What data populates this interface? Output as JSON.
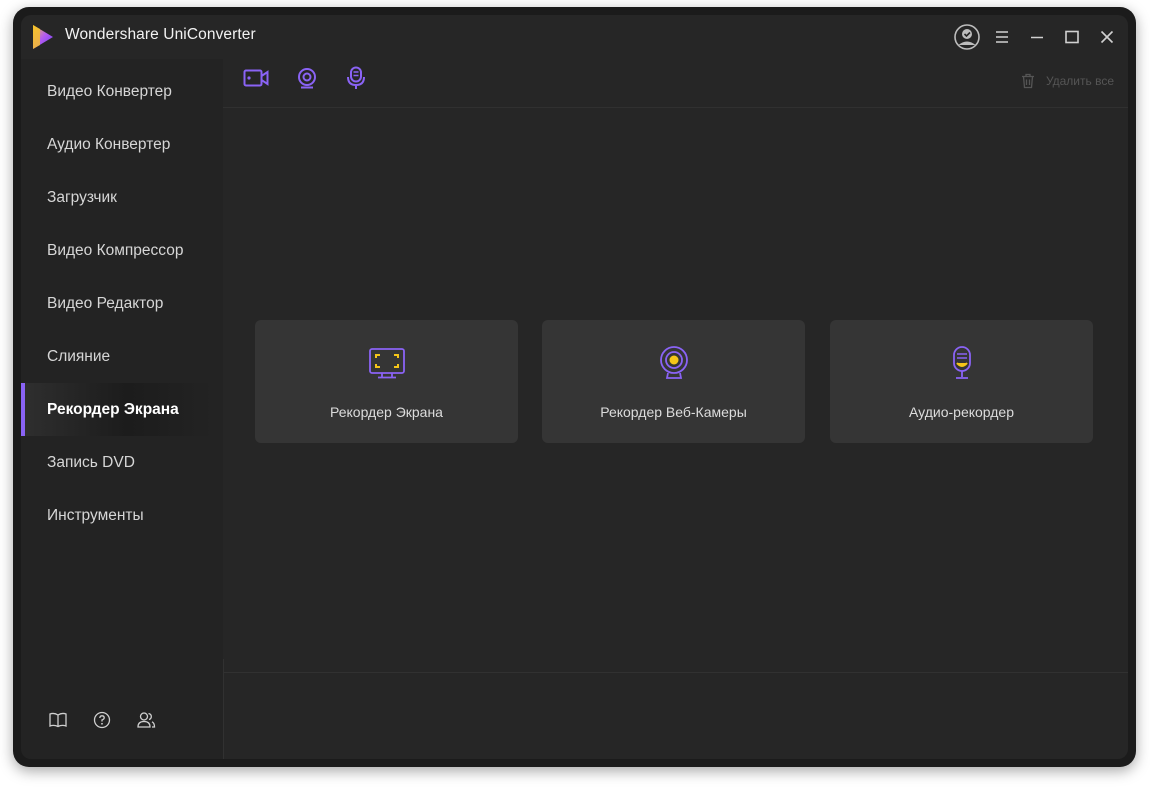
{
  "app": {
    "title": "Wondershare UniConverter",
    "accent_color": "#8a63f5",
    "highlight_color": "#f5c518"
  },
  "window_controls": {
    "icons": [
      "account-icon",
      "menu-icon",
      "minimize-icon",
      "maximize-icon",
      "close-icon"
    ]
  },
  "sidebar": {
    "items": [
      {
        "label": "Видео Конвертер"
      },
      {
        "label": "Аудио Конвертер"
      },
      {
        "label": "Загрузчик"
      },
      {
        "label": "Видео Компрессор"
      },
      {
        "label": "Видео Редактор"
      },
      {
        "label": "Слияние"
      },
      {
        "label": "Рекордер Экрана",
        "active": true
      },
      {
        "label": "Запись DVD"
      },
      {
        "label": "Инструменты"
      }
    ],
    "bottom_icons": [
      "book-icon",
      "help-icon",
      "community-icon"
    ]
  },
  "toolbar": {
    "icons": [
      "video-camera-icon",
      "webcam-icon",
      "microphone-icon"
    ],
    "delete_all_label": "Удалить все"
  },
  "cards": [
    {
      "label": "Рекордер Экрана",
      "icon": "screen-record-icon"
    },
    {
      "label": "Рекордер Веб-Камеры",
      "icon": "webcam-record-icon"
    },
    {
      "label": "Аудио-рекордер",
      "icon": "audio-record-icon"
    }
  ]
}
